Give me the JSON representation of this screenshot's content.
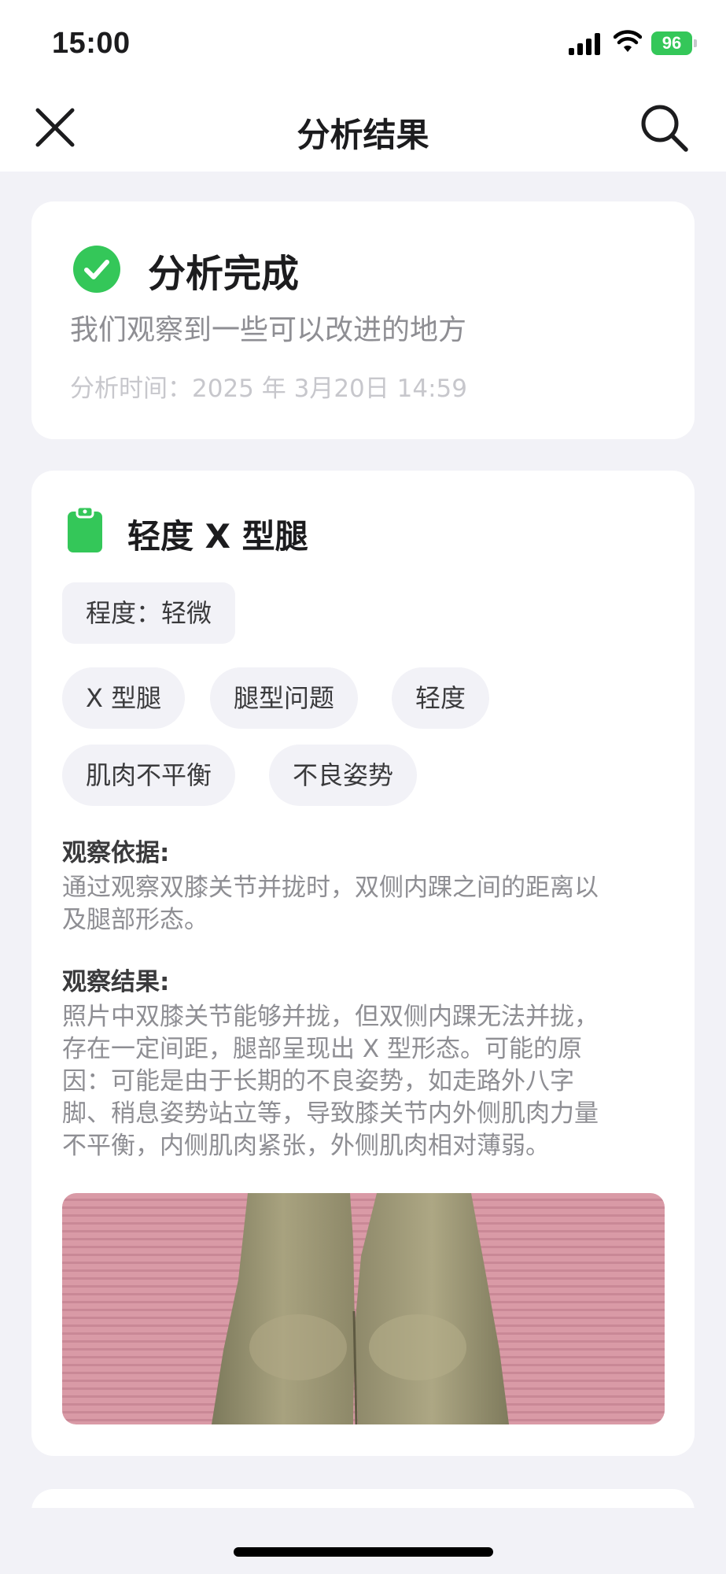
{
  "status_bar": {
    "time": "15:00",
    "battery": "96",
    "icons": [
      "signal-icon",
      "wifi-icon",
      "battery-icon"
    ]
  },
  "nav": {
    "title": "分析结果",
    "close_icon": "close-icon",
    "search_icon": "search-icon"
  },
  "summary": {
    "title": "分析完成",
    "subtitle": "我们观察到一些可以改进的地方",
    "time_label": "分析时间：2025 年 3月20日 14:59",
    "icon": "check-circle-icon"
  },
  "detail": {
    "icon": "clipboard-icon",
    "title": "轻度 X 型腿",
    "severity": "程度：轻微",
    "tags": [
      "X 型腿",
      "腿型问题",
      "轻度",
      "肌肉不平衡",
      "不良姿势"
    ],
    "basis_label": "观察依据:",
    "basis_lines": [
      "通过观察双膝关节并拢时，双侧内踝之间的距离以",
      "及腿部形态。"
    ],
    "result_label": "观察结果:",
    "result_lines": [
      "照片中双膝关节能够并拢，但双侧内踝无法并拢，",
      "存在一定间距，腿部呈现出 X 型形态。可能的原",
      "因：可能是由于长期的不良姿势，如走路外八字",
      "脚、稍息姿势站立等，导致膝关节内外侧肌肉力量",
      "不平衡，内侧肌肉紧张，外侧肌肉相对薄弱。"
    ]
  },
  "colors": {
    "accent_green": "#34c759",
    "background": "#f2f2f7",
    "card": "#ffffff",
    "mat_pink": "#d99aa6"
  }
}
